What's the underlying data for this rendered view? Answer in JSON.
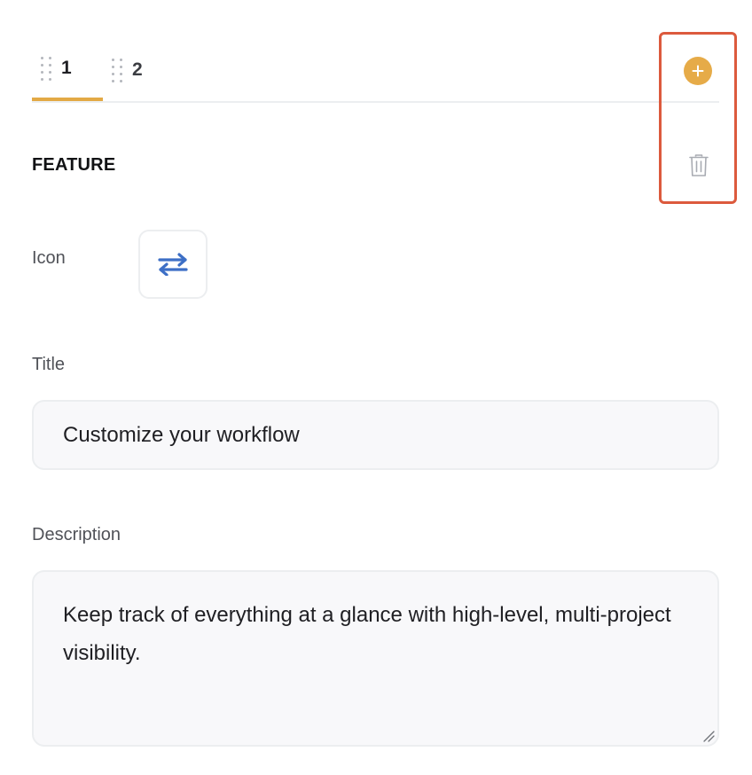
{
  "tabs": [
    {
      "label": "1",
      "active": true
    },
    {
      "label": "2",
      "active": false
    }
  ],
  "actions": {
    "add_icon": "plus-circle-icon",
    "delete_icon": "trash-icon",
    "highlight_color": "#dc5a3d"
  },
  "section": {
    "title": "FEATURE"
  },
  "icon_field": {
    "label": "Icon",
    "value_icon": "arrows-left-right-icon",
    "icon_color": "#3d6fc6"
  },
  "title_field": {
    "label": "Title",
    "value": "Customize your workflow"
  },
  "description_field": {
    "label": "Description",
    "value": "Keep track of everything at a glance with high-level, multi-project visibility."
  },
  "colors": {
    "accent": "#e3a945",
    "border": "#eceef0",
    "input_bg": "#f8f8fa"
  }
}
